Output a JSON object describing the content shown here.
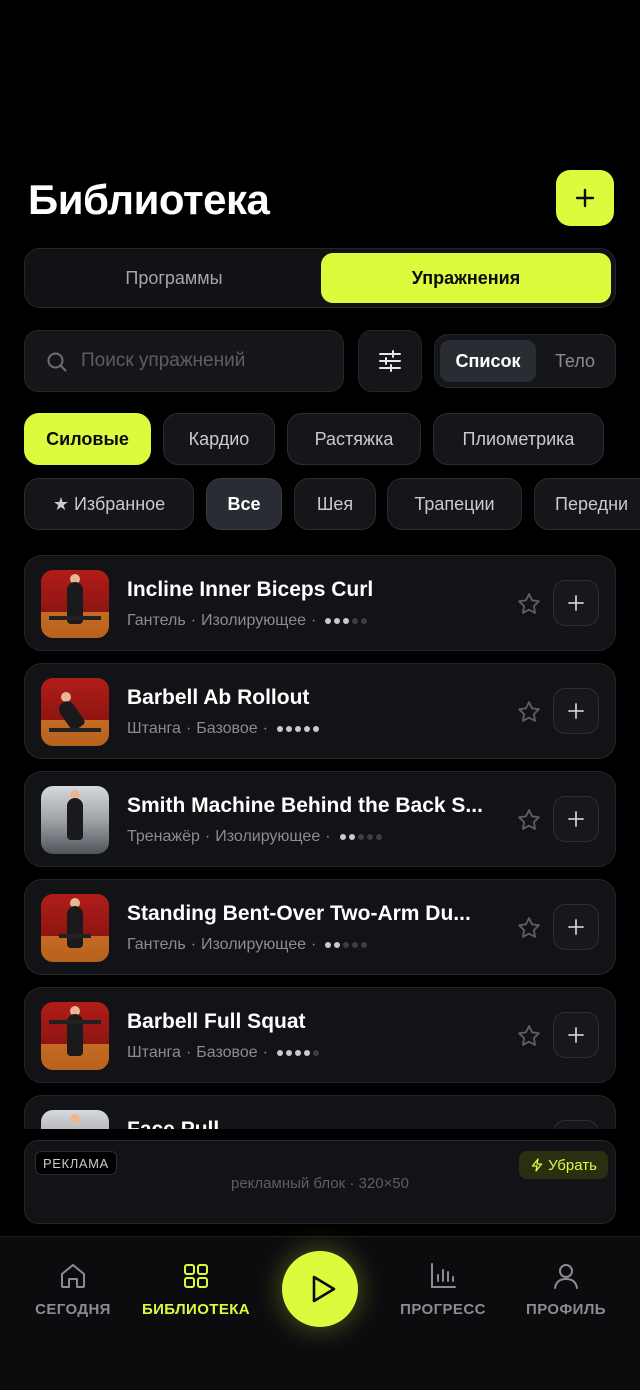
{
  "header": {
    "title": "Библиотека",
    "add_icon": "plus-icon"
  },
  "segments": [
    {
      "label": "Программы",
      "active": false
    },
    {
      "label": "Упражнения",
      "active": true
    }
  ],
  "search": {
    "placeholder": "Поиск упражнений",
    "value": ""
  },
  "view_toggle": [
    {
      "label": "Список",
      "active": true
    },
    {
      "label": "Тело",
      "active": false
    }
  ],
  "categories": [
    "Силовые",
    "Кардио",
    "Растяжка",
    "Плиометрика"
  ],
  "muscles": [
    "★ Избранное",
    "Все",
    "Шея",
    "Трапеции",
    "Передни"
  ],
  "exercises": [
    {
      "name": "Incline Inner Biceps Curl",
      "equipment": "Гантель",
      "type": "Изолирующее",
      "level": 3
    },
    {
      "name": "Barbell Ab Rollout",
      "equipment": "Штанга",
      "type": "Базовое",
      "level": 5
    },
    {
      "name": "Smith Machine Behind the Back S...",
      "equipment": "Тренажёр",
      "type": "Изолирующее",
      "level": 2
    },
    {
      "name": "Standing Bent-Over Two-Arm Du...",
      "equipment": "Гантель",
      "type": "Изолирующее",
      "level": 2
    },
    {
      "name": "Barbell Full Squat",
      "equipment": "Штанга",
      "type": "Базовое",
      "level": 4
    },
    {
      "name": "Face Pull",
      "equipment": "",
      "type": "",
      "level": 0
    }
  ],
  "ad": {
    "label": "РЕКЛАМА",
    "remove_label": "Убрать",
    "placeholder": "рекламный блок · 320×50"
  },
  "nav": [
    {
      "label": "СЕГОДНЯ",
      "icon": "home-icon",
      "active": false
    },
    {
      "label": "БИБЛИОТЕКА",
      "icon": "grid-icon",
      "active": true
    },
    {
      "label": "ПРОГРЕСС",
      "icon": "chart-icon",
      "active": false
    },
    {
      "label": "ПРОФИЛЬ",
      "icon": "user-icon",
      "active": false
    }
  ],
  "colors": {
    "accent": "#dcfb3c",
    "background": "#000000",
    "card": "#121317"
  }
}
